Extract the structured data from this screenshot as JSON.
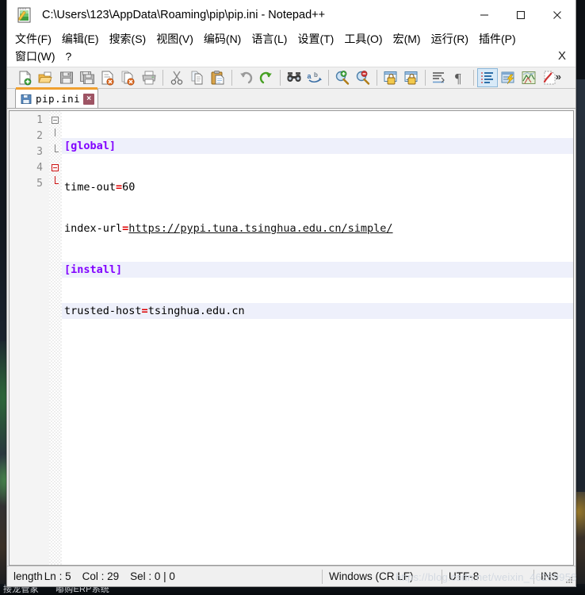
{
  "window": {
    "title": "C:\\Users\\123\\AppData\\Roaming\\pip\\pip.ini - Notepad++",
    "app_icon": "notepad-pencil-icon",
    "controls": {
      "minimize": "minimize-icon",
      "maximize": "maximize-icon",
      "close": "close-icon"
    }
  },
  "menu": {
    "row1": [
      {
        "label": "文件(F)",
        "mnemonic": "F"
      },
      {
        "label": "编辑(E)",
        "mnemonic": "E"
      },
      {
        "label": "搜索(S)",
        "mnemonic": "S"
      },
      {
        "label": "视图(V)",
        "mnemonic": "V"
      },
      {
        "label": "编码(N)",
        "mnemonic": "N"
      },
      {
        "label": "语言(L)",
        "mnemonic": "L"
      },
      {
        "label": "设置(T)",
        "mnemonic": "T"
      },
      {
        "label": "工具(O)",
        "mnemonic": "O"
      },
      {
        "label": "宏(M)",
        "mnemonic": "M"
      },
      {
        "label": "运行(R)",
        "mnemonic": "R"
      },
      {
        "label": "插件(P)",
        "mnemonic": "P"
      }
    ],
    "row2": [
      {
        "label": "窗口(W)",
        "mnemonic": "W"
      },
      {
        "label": "?",
        "mnemonic": ""
      }
    ],
    "close_document": "X"
  },
  "toolbar": {
    "overflow": "»",
    "buttons": [
      {
        "name": "new-file-icon",
        "tooltip": "新建"
      },
      {
        "name": "open-file-icon",
        "tooltip": "打开"
      },
      {
        "name": "save-icon",
        "tooltip": "保存"
      },
      {
        "name": "save-all-icon",
        "tooltip": "保存所有"
      },
      {
        "name": "close-file-icon",
        "tooltip": "关闭"
      },
      {
        "name": "close-all-icon",
        "tooltip": "关闭所有"
      },
      {
        "name": "print-icon",
        "tooltip": "打印"
      },
      {
        "name": "cut-icon",
        "tooltip": "剪切"
      },
      {
        "name": "copy-icon",
        "tooltip": "复制"
      },
      {
        "name": "paste-icon",
        "tooltip": "粘贴"
      },
      {
        "name": "undo-icon",
        "tooltip": "撤销"
      },
      {
        "name": "redo-icon",
        "tooltip": "重做"
      },
      {
        "name": "find-icon",
        "tooltip": "查找"
      },
      {
        "name": "replace-icon",
        "tooltip": "替换"
      },
      {
        "name": "zoom-in-icon",
        "tooltip": "放大"
      },
      {
        "name": "zoom-out-icon",
        "tooltip": "缩小"
      },
      {
        "name": "sync-vertical-scroll-icon",
        "tooltip": "同步垂直滚动"
      },
      {
        "name": "sync-horizontal-scroll-icon",
        "tooltip": "同步水平滚动"
      },
      {
        "name": "word-wrap-icon",
        "tooltip": "自动换行"
      },
      {
        "name": "show-all-characters-icon",
        "tooltip": "显示所有字符"
      },
      {
        "name": "indent-guide-icon",
        "tooltip": "显示缩进参考线",
        "active": true
      },
      {
        "name": "user-defined-dialog-icon",
        "tooltip": "用户自定义语言"
      },
      {
        "name": "document-map-icon",
        "tooltip": "文档地图"
      },
      {
        "name": "function-list-icon",
        "tooltip": "函数列表"
      }
    ]
  },
  "tabs": [
    {
      "name": "pip.ini",
      "icon": "save-blue-icon",
      "close": "×",
      "active": true
    }
  ],
  "editor": {
    "lines": [
      {
        "number": "1",
        "highlight": true,
        "fold": "open-gray",
        "tokens": [
          {
            "text": "[global]",
            "type": "section"
          }
        ]
      },
      {
        "number": "2",
        "highlight": false,
        "fold": "line-gray",
        "tokens": [
          {
            "text": "time-out",
            "type": "key"
          },
          {
            "text": "=",
            "type": "equals"
          },
          {
            "text": "60",
            "type": "value"
          }
        ]
      },
      {
        "number": "3",
        "highlight": false,
        "fold": "end-gray",
        "tokens": [
          {
            "text": "index-url",
            "type": "key"
          },
          {
            "text": "=",
            "type": "equals"
          },
          {
            "text": "https://pypi.tuna.tsinghua.edu.cn/simple/",
            "type": "url"
          }
        ]
      },
      {
        "number": "4",
        "highlight": true,
        "fold": "open-red",
        "tokens": [
          {
            "text": "[install]",
            "type": "section"
          }
        ]
      },
      {
        "number": "5",
        "highlight": true,
        "fold": "end-red",
        "tokens": [
          {
            "text": "trusted-host",
            "type": "key"
          },
          {
            "text": "=",
            "type": "equals"
          },
          {
            "text": "tsinghua.edu.cn",
            "type": "value"
          }
        ]
      }
    ]
  },
  "statusbar": {
    "length_label": "length",
    "line": "Ln : 5",
    "col": "Col : 29",
    "sel": "Sel : 0 | 0",
    "eol": "Windows (CR LF)",
    "encoding": "UTF-8",
    "insert_mode": "INS",
    "watermark": "https://blog.csdn.net/weixin_46269958"
  },
  "taskbar": {
    "item1": "接龙管家",
    "item2": "嘟购ERP系统"
  },
  "colors": {
    "section": "#8000ff",
    "equals": "#dd0000",
    "tab_active_top": "#f0a030",
    "tab_close_bg": "#9e5464",
    "line_highlight": "#eef0fb",
    "fold_active": "#cc1111"
  }
}
